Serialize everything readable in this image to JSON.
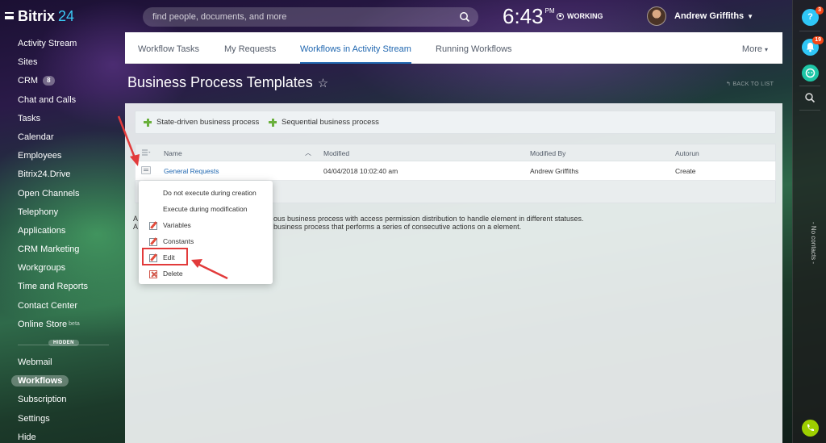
{
  "header": {
    "logo_text": "Bitrix",
    "logo_number": "24",
    "search_placeholder": "find people, documents, and more",
    "clock_time": "6:43",
    "clock_ampm": "PM",
    "work_status": "WORKING",
    "user_name": "Andrew Griffiths"
  },
  "sidebar": {
    "items": [
      {
        "label": "Activity Stream"
      },
      {
        "label": "Sites"
      },
      {
        "label": "CRM",
        "badge": "8"
      },
      {
        "label": "Chat and Calls"
      },
      {
        "label": "Tasks"
      },
      {
        "label": "Calendar"
      },
      {
        "label": "Employees"
      },
      {
        "label": "Bitrix24.Drive"
      },
      {
        "label": "Open Channels"
      },
      {
        "label": "Telephony"
      },
      {
        "label": "Applications"
      },
      {
        "label": "CRM Marketing"
      },
      {
        "label": "Workgroups"
      },
      {
        "label": "Time and Reports"
      },
      {
        "label": "Contact Center"
      },
      {
        "label": "Online Store",
        "sup": "beta"
      }
    ],
    "hidden_label": "HIDDEN",
    "hidden_items": [
      {
        "label": "Webmail"
      },
      {
        "label": "Workflows",
        "active": true
      },
      {
        "label": "Subscription"
      },
      {
        "label": "Settings"
      },
      {
        "label": "Hide"
      }
    ]
  },
  "rightbar": {
    "help_label": "?",
    "help_count": "3",
    "notif_count": "19",
    "vertical_text": "- No contacts -"
  },
  "tabs": {
    "items": [
      {
        "label": "Workflow Tasks"
      },
      {
        "label": "My Requests"
      },
      {
        "label": "Workflows in Activity Stream",
        "active": true
      },
      {
        "label": "Running Workflows"
      }
    ],
    "more_label": "More"
  },
  "page": {
    "title": "Business Process Templates",
    "back_label": "BACK TO LIST"
  },
  "toolbar": {
    "state_driven_label": "State-driven business process",
    "sequential_label": "Sequential business process"
  },
  "grid": {
    "columns": [
      "Name",
      "Modified",
      "Modified By",
      "Autorun"
    ],
    "rows": [
      {
        "name": "General Requests",
        "modified": "04/04/2018 10:02:40 am",
        "modified_by": "Andrew Griffiths",
        "autorun": "Create"
      }
    ]
  },
  "legend": {
    "line1_prefix": "A",
    "line1_text": "ous business process with access permission distribution to handle element in different statuses.",
    "line2_prefix": "A",
    "line2_text": "business process that performs a series of consecutive actions on a element."
  },
  "context_menu": {
    "items": [
      {
        "label": "Do not execute during creation",
        "icon": "none"
      },
      {
        "label": "Execute during modification",
        "icon": "none"
      },
      {
        "label": "Variables",
        "icon": "edit-icon"
      },
      {
        "label": "Constants",
        "icon": "edit-icon"
      },
      {
        "label": "Edit",
        "icon": "edit-icon",
        "highlighted": true
      },
      {
        "label": "Delete",
        "icon": "delete-icon"
      }
    ]
  },
  "colors": {
    "accent_blue": "#2067b0",
    "highlight_red": "#e23b3b",
    "green_plus": "#6ab03c",
    "rightbar_cyan": "#2fc6f6"
  }
}
